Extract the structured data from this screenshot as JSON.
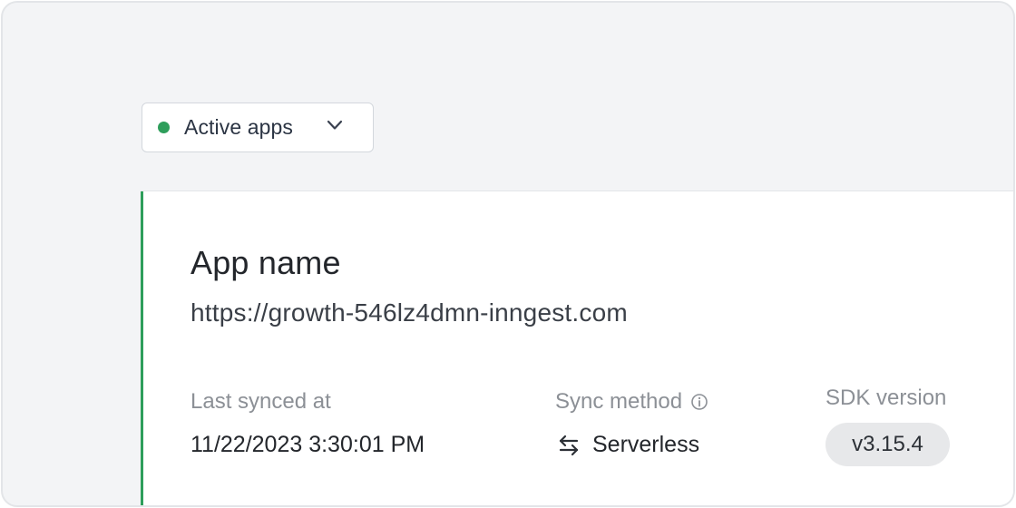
{
  "filter": {
    "label": "Active apps",
    "status_color": "#2e9e5b",
    "status_icon": "status-dot",
    "chevron_icon": "chevron-down-icon"
  },
  "app": {
    "name": "App name",
    "url": "https://growth-546lz4dmn-inngest.com",
    "accent_color": "#2e9e5b",
    "last_synced_label": "Last synced at",
    "last_synced_value": "11/22/2023 3:30:01 PM",
    "sync_method_label": "Sync method",
    "sync_method_info_icon": "info-icon",
    "sync_method_icon": "arrows-swap-icon",
    "sync_method_value": "Serverless",
    "sdk_version_label": "SDK version",
    "sdk_version_value": "v3.15.4"
  }
}
